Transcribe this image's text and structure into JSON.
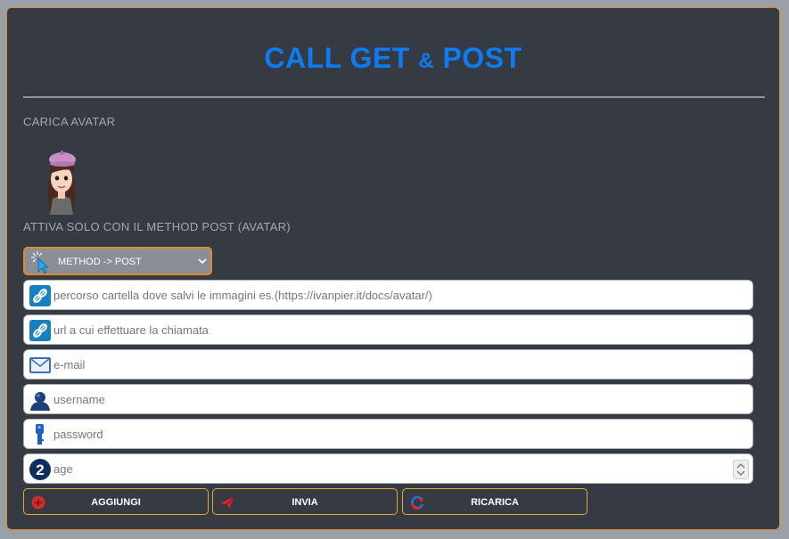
{
  "title": {
    "part1": "CALL GET",
    "amp": "&",
    "part2": "POST"
  },
  "avatar_section": {
    "label": "CARICA AVATAR"
  },
  "post_section": {
    "label": "ATTIVA SOLO CON IL METHOD POST (AVATAR)"
  },
  "method_select": {
    "value": "METHOD -> POST"
  },
  "fields": {
    "folder_path": {
      "placeholder": "percorso cartella dove salvi le immagini es.(https://ivanpier.it/docs/avatar/)",
      "icon": "link-icon"
    },
    "call_url": {
      "placeholder": "url a cui effettuare la chiamata",
      "icon": "link-icon"
    },
    "email": {
      "placeholder": "e-mail",
      "icon": "envelope-icon"
    },
    "username": {
      "placeholder": "username",
      "icon": "user-icon"
    },
    "password": {
      "placeholder": "password",
      "icon": "key-icon"
    },
    "age": {
      "placeholder": "age",
      "icon": "number-two-icon"
    }
  },
  "buttons": {
    "add": {
      "label": "AGGIUNGI",
      "icon": "plus-circle-icon"
    },
    "send": {
      "label": "INVIA",
      "icon": "paper-plane-icon"
    },
    "reload": {
      "label": "RICARICA",
      "icon": "reload-icon"
    }
  },
  "colors": {
    "accent": "#0d7cf2",
    "border_orange": "#d98a2b",
    "panel_bg": "#363a42"
  }
}
